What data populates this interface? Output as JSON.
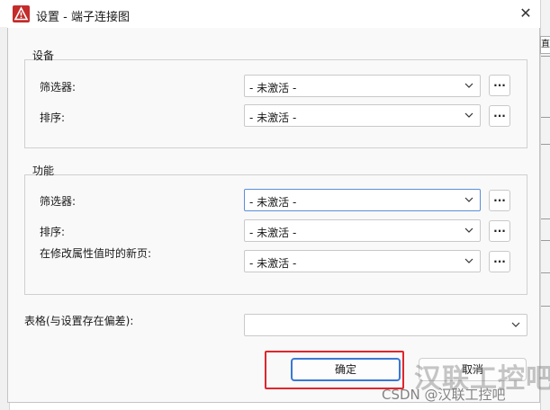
{
  "window": {
    "title": "设置 - 端子连接图",
    "close_label": "✕"
  },
  "device_group": {
    "label": "设备",
    "rows": [
      {
        "label": "筛选器:",
        "value": "- 未激活 -",
        "button": "..."
      },
      {
        "label": "排序:",
        "value": "- 未激活 -",
        "button": "..."
      }
    ]
  },
  "function_group": {
    "label": "功能",
    "rows": [
      {
        "label": "筛选器:",
        "value": "- 未激活 -",
        "button": "..."
      },
      {
        "label": "排序:",
        "value": "- 未激活 -",
        "button": "..."
      },
      {
        "label": "在修改属性值时的新页:",
        "value": "- 未激活 -",
        "button": "..."
      }
    ]
  },
  "table_row": {
    "label": "表格(与设置存在偏差):",
    "value": ""
  },
  "buttons": {
    "ok": "确定",
    "cancel": "取消"
  },
  "watermark": {
    "big": "汉联工控吧",
    "small": "CSDN @汉联工控吧"
  },
  "background": {
    "corner_text": "直"
  },
  "colors": {
    "focus": "#3b78d4",
    "highlight": "#e0262c",
    "app_icon": "#c42b2b"
  }
}
